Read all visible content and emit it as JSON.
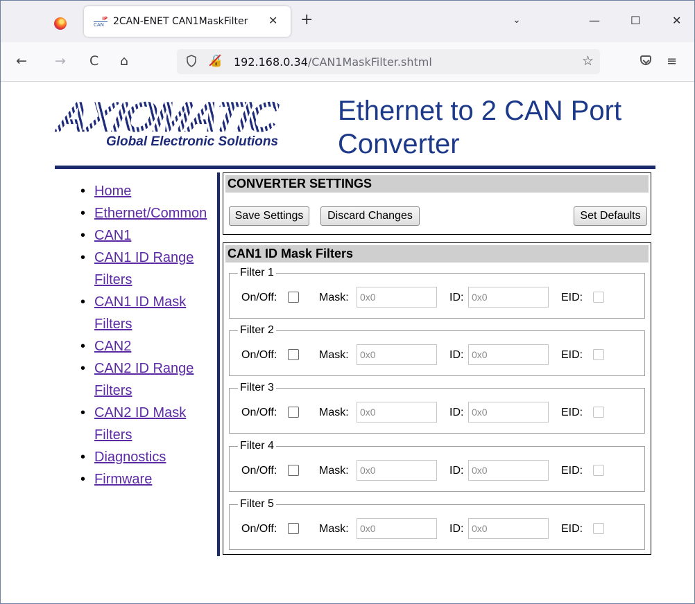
{
  "browser": {
    "tab_title": "2CAN-ENET CAN1MaskFilter",
    "tab_favicon_top": "IP",
    "tab_favicon_bottom": "CAN",
    "close_tab": "✕",
    "new_tab": "+",
    "tabs_menu": "⌄",
    "minimize": "—",
    "maximize": "☐",
    "close_window": "✕",
    "back": "←",
    "forward": "→",
    "reload": "C",
    "home": "⌂",
    "url_host": "192.168.0.34",
    "url_path": "/CAN1MaskFilter.shtml",
    "bookmark": "☆",
    "menu": "≡",
    "icons": [
      "firefox-icon",
      "shield-icon",
      "lock-insecure-icon",
      "star-icon",
      "pocket-icon",
      "hamburger-icon"
    ]
  },
  "header": {
    "logo_text": "AXIOMATIC",
    "logo_tagline": "Global Electronic Solutions",
    "title_line1": "Ethernet to 2 CAN Port",
    "title_line2": "Converter",
    "brand_color": "#1d2a78"
  },
  "menu": [
    {
      "label": "Home"
    },
    {
      "label": "Ethernet/Common"
    },
    {
      "label": "CAN1"
    },
    {
      "label": "CAN1 ID Range Filters"
    },
    {
      "label": "CAN1 ID Mask Filters"
    },
    {
      "label": "CAN2"
    },
    {
      "label": "CAN2 ID Range Filters"
    },
    {
      "label": "CAN2 ID Mask Filters"
    },
    {
      "label": "Diagnostics"
    },
    {
      "label": "Firmware"
    }
  ],
  "converter": {
    "title": "CONVERTER SETTINGS",
    "save": "Save Settings",
    "discard": "Discard Changes",
    "defaults": "Set Defaults"
  },
  "mask_filters": {
    "title": "CAN1 ID Mask Filters",
    "onoff_label": "On/Off:",
    "mask_label": "Mask:",
    "id_label": "ID:",
    "eid_label": "EID:",
    "filters": [
      {
        "legend": "Filter 1",
        "on": false,
        "mask": "0x0",
        "id": "0x0",
        "eid": false
      },
      {
        "legend": "Filter 2",
        "on": false,
        "mask": "0x0",
        "id": "0x0",
        "eid": false
      },
      {
        "legend": "Filter 3",
        "on": false,
        "mask": "0x0",
        "id": "0x0",
        "eid": false
      },
      {
        "legend": "Filter 4",
        "on": false,
        "mask": "0x0",
        "id": "0x0",
        "eid": false
      },
      {
        "legend": "Filter 5",
        "on": false,
        "mask": "0x0",
        "id": "0x0",
        "eid": false
      }
    ]
  }
}
